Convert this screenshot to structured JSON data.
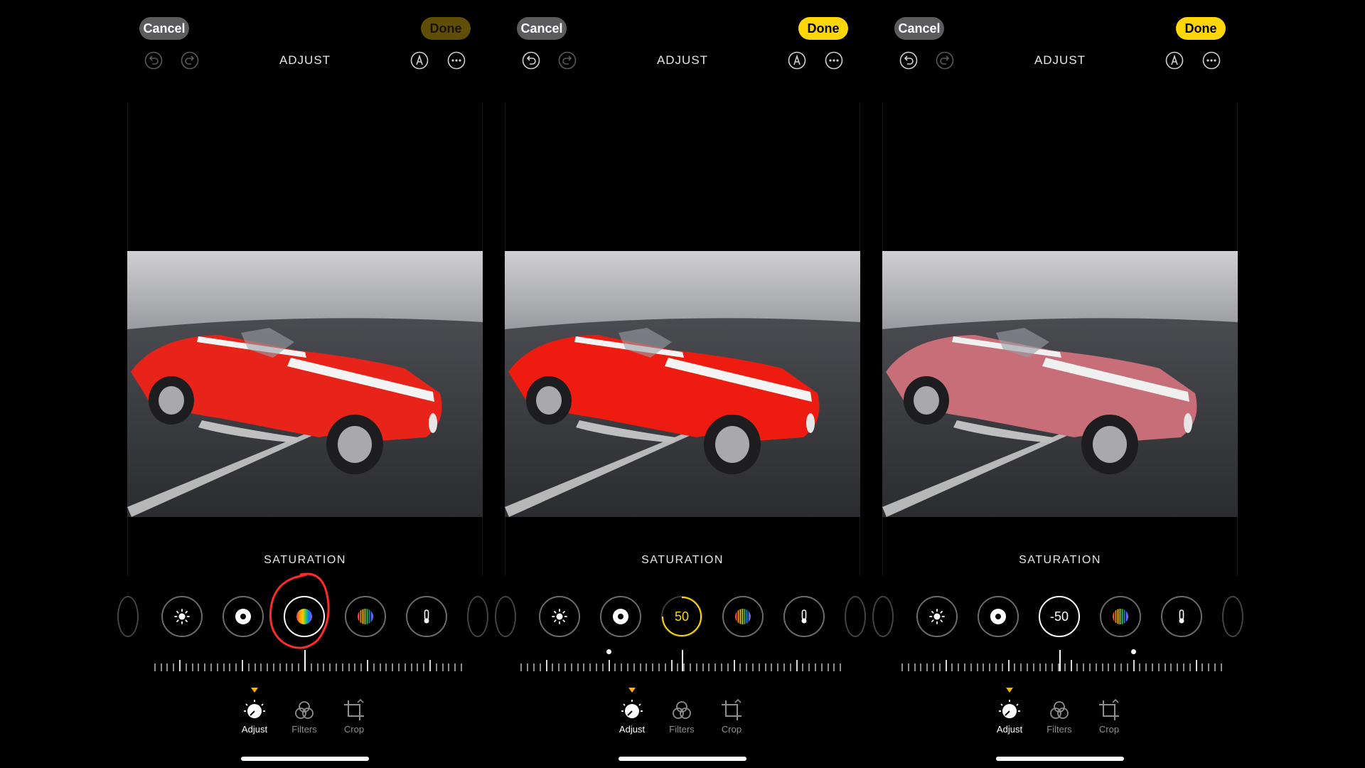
{
  "colors": {
    "accent_yellow": "#ffd60a",
    "done_dim": "#5f4e07",
    "annotation_red": "#ff2a2a",
    "car_red": "#e8241a",
    "car_red_desat": "#c86e78"
  },
  "panels": [
    {
      "cancel_label": "Cancel",
      "done_label": "Done",
      "done_state": "dim",
      "title": "ADJUST",
      "adjustment_label": "SATURATION",
      "selected_tool_display": "",
      "slider_value": 0,
      "annotated": true,
      "tabs": [
        {
          "label": "Adjust",
          "icon": "adjust-dial-icon",
          "selected": true
        },
        {
          "label": "Filters",
          "icon": "filters-icon",
          "selected": false
        },
        {
          "label": "Crop",
          "icon": "crop-icon",
          "selected": false
        }
      ]
    },
    {
      "cancel_label": "Cancel",
      "done_label": "Done",
      "done_state": "active",
      "title": "ADJUST",
      "adjustment_label": "SATURATION",
      "selected_tool_display": "50",
      "slider_value": 50,
      "annotated": false,
      "tabs": [
        {
          "label": "Adjust",
          "icon": "adjust-dial-icon",
          "selected": true
        },
        {
          "label": "Filters",
          "icon": "filters-icon",
          "selected": false
        },
        {
          "label": "Crop",
          "icon": "crop-icon",
          "selected": false
        }
      ]
    },
    {
      "cancel_label": "Cancel",
      "done_label": "Done",
      "done_state": "active",
      "title": "ADJUST",
      "adjustment_label": "SATURATION",
      "selected_tool_display": "-50",
      "slider_value": -50,
      "annotated": false,
      "tabs": [
        {
          "label": "Adjust",
          "icon": "adjust-dial-icon",
          "selected": true
        },
        {
          "label": "Filters",
          "icon": "filters-icon",
          "selected": false
        },
        {
          "label": "Crop",
          "icon": "crop-icon",
          "selected": false
        }
      ]
    }
  ],
  "tool_icons": [
    "brightness-icon",
    "black-point-icon",
    "saturation-icon",
    "vibrance-icon",
    "warmth-icon"
  ]
}
